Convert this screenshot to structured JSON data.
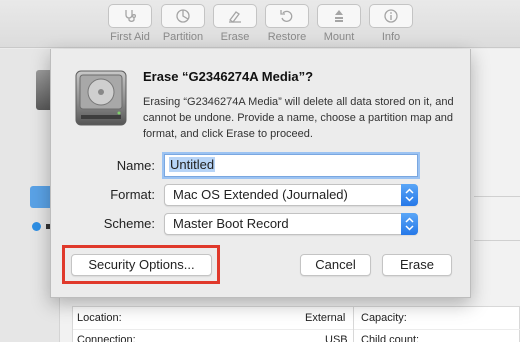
{
  "toolbar": {
    "items": [
      {
        "label": "First Aid",
        "icon": "stethoscope-icon"
      },
      {
        "label": "Partition",
        "icon": "partition-icon"
      },
      {
        "label": "Erase",
        "icon": "erase-icon"
      },
      {
        "label": "Restore",
        "icon": "restore-icon"
      },
      {
        "label": "Mount",
        "icon": "mount-icon"
      },
      {
        "label": "Info",
        "icon": "info-icon"
      }
    ]
  },
  "dialog": {
    "title": "Erase “G2346274A Media”?",
    "description": "Erasing “G2346274A Media” will delete all data stored on it, and cannot be undone. Provide a name, choose a partition map and format, and click Erase to proceed.",
    "name_label": "Name:",
    "name_value": "Untitled",
    "format_label": "Format:",
    "format_value": "Mac OS Extended (Journaled)",
    "scheme_label": "Scheme:",
    "scheme_value": "Master Boot Record",
    "security_button": "Security Options...",
    "cancel_button": "Cancel",
    "erase_button": "Erase"
  },
  "info_table": {
    "location_label": "Location:",
    "location_value": "External",
    "capacity_label": "Capacity:",
    "connection_label": "Connection:",
    "connection_value": "USB",
    "child_count_label": "Child count:"
  },
  "colors": {
    "accent": "#2578e8",
    "highlight": "#e0392b"
  }
}
